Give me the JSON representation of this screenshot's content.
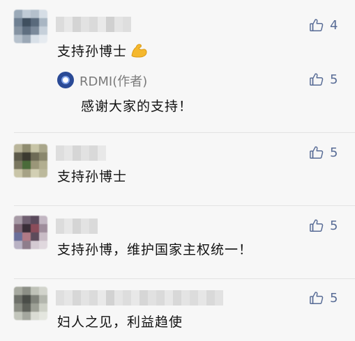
{
  "comments": [
    {
      "text": "支持孙博士",
      "likes": "4",
      "emoji": "flexed-biceps",
      "reply": {
        "author": "RDMI(作者)",
        "text": "感谢大家的支持！",
        "likes": "5"
      }
    },
    {
      "text": "支持孙博士",
      "likes": "5"
    },
    {
      "text": "支持孙博，维护国家主权统一！",
      "likes": "5"
    },
    {
      "text": "妇人之见，利益趋使",
      "likes": "5"
    }
  ],
  "colors": {
    "background": "#f7f7f7",
    "like_color": "#576b95",
    "author_color": "#7a7a7a",
    "logo_color": "#2a4a96"
  },
  "icons": {
    "like": "thumbs-up-outline-icon",
    "emoji": "flexed-biceps-emoji",
    "author_logo": "rdmi-logo"
  }
}
